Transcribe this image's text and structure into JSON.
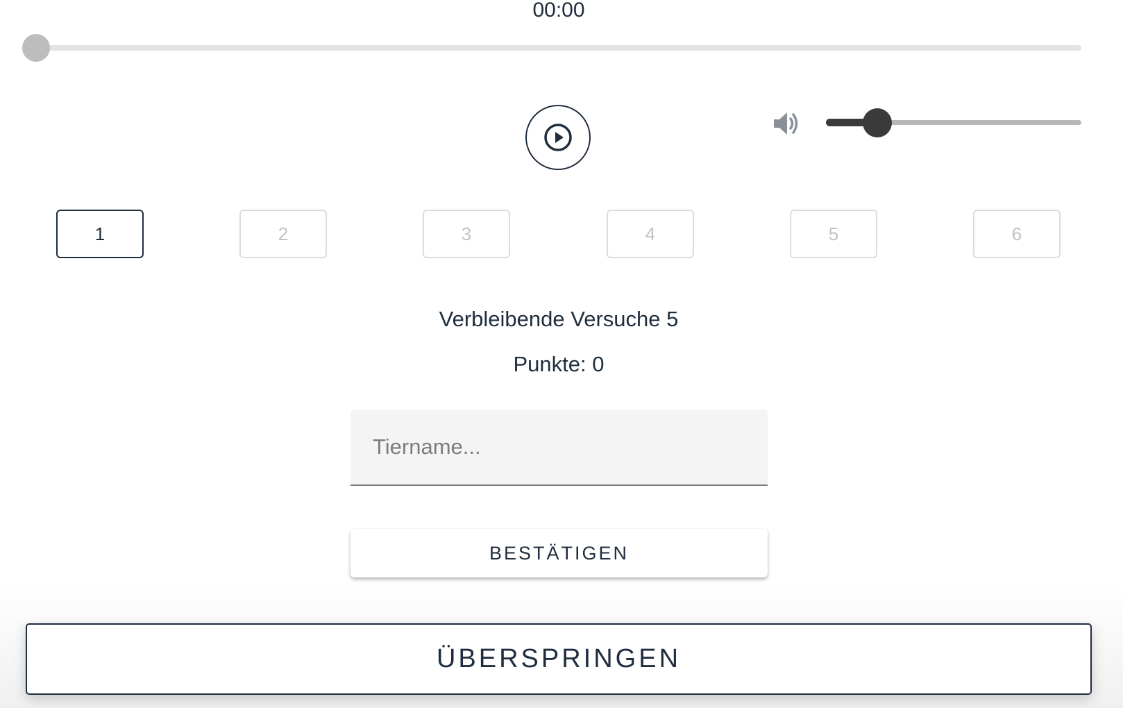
{
  "player": {
    "time": "00:00",
    "progress": 0,
    "volume": 0.2,
    "play_icon": "play-circle-icon",
    "volume_icon": "volume-high-icon"
  },
  "steps": {
    "items": [
      "1",
      "2",
      "3",
      "4",
      "5",
      "6"
    ],
    "active_index": 0
  },
  "status": {
    "attempts_text": "Verbleibende Versuche 5",
    "points_text": "Punkte: 0"
  },
  "guess": {
    "value": "",
    "placeholder": "Tiername..."
  },
  "actions": {
    "confirm_label": "BESTÄTIGEN",
    "skip_label": "ÜBERSPRINGEN"
  },
  "colors": {
    "primary_text": "#1f2d3d",
    "inactive_step": "#c2c2c2",
    "slider_dark": "#3a3a3a",
    "progress_thumb": "#bdbdbd"
  }
}
